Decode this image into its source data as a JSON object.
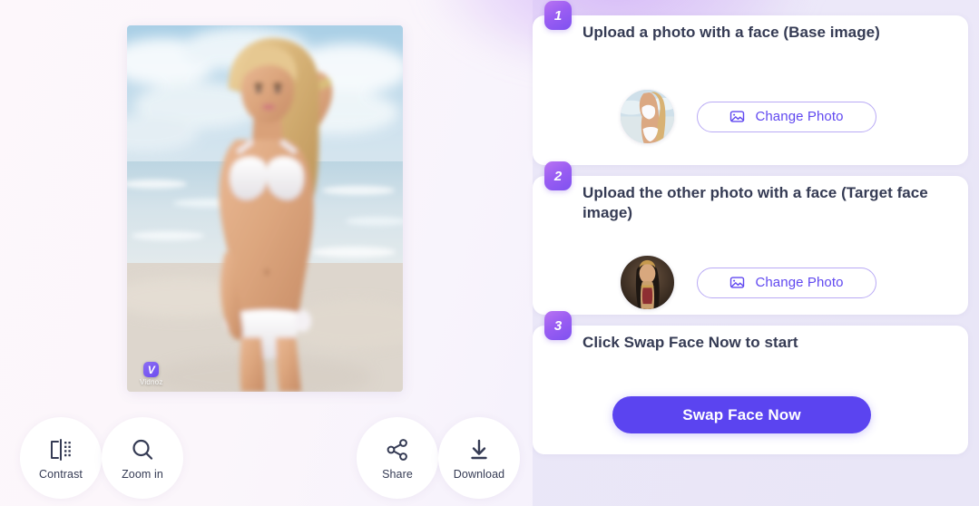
{
  "app": {
    "watermark_label": "Vidnoz",
    "watermark_mark": "V"
  },
  "preview": {
    "image_alt": "Swapped result photo - blonde woman in white bikini on a beach"
  },
  "tools": [
    {
      "id": "contrast",
      "label": "Contrast",
      "icon": "contrast-icon"
    },
    {
      "id": "zoom-in",
      "label": "Zoom in",
      "icon": "magnifier-icon"
    },
    {
      "id": "share",
      "label": "Share",
      "icon": "share-icon"
    },
    {
      "id": "download",
      "label": "Download",
      "icon": "download-arrow-icon"
    }
  ],
  "steps": [
    {
      "number": "1",
      "title": "Upload a photo with a face (Base image)",
      "button_label": "Change Photo",
      "thumb_alt": "Base image thumbnail"
    },
    {
      "number": "2",
      "title": "Upload the other photo with a face (Target face image)",
      "button_label": "Change Photo",
      "thumb_alt": "Target face thumbnail"
    },
    {
      "number": "3",
      "title": "Click Swap Face Now to start",
      "action_label": "Swap Face Now"
    }
  ],
  "colors": {
    "accent": "#5b44f0",
    "badge_gradient_start": "#b974f2",
    "badge_gradient_end": "#7f52f0",
    "outline_button_border": "#b9aaf5",
    "outline_button_text": "#6048f0",
    "text_primary": "#353b54",
    "panel_background": "#e9e6f7",
    "card_background": "#ffffff"
  }
}
